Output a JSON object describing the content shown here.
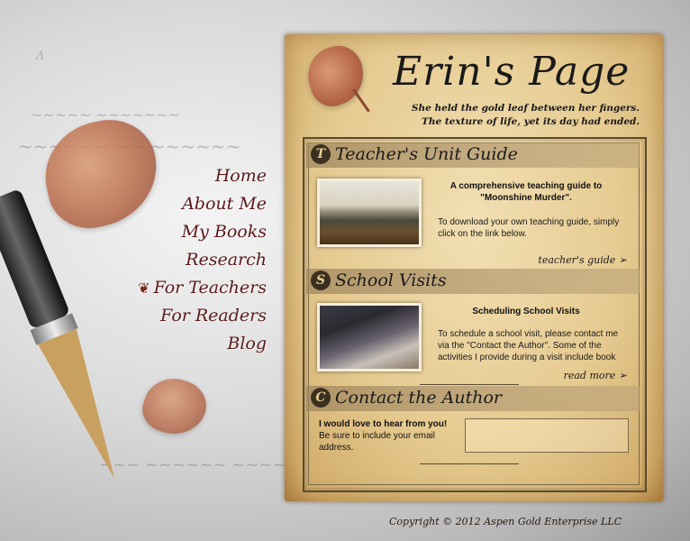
{
  "site": {
    "title": "Erin's Page",
    "tagline_line1": "She held the gold leaf between her fingers.",
    "tagline_line2": "The texture of life, yet its day had ended."
  },
  "nav": {
    "items": [
      {
        "label": "Home"
      },
      {
        "label": "About Me"
      },
      {
        "label": "My Books"
      },
      {
        "label": "Research"
      },
      {
        "label": "For Teachers"
      },
      {
        "label": "For Readers"
      },
      {
        "label": "Blog"
      }
    ]
  },
  "sections": {
    "teacher": {
      "cap": "T",
      "heading": "Teacher's Unit Guide",
      "title": "A comprehensive teaching guide to \"Moonshine Murder\".",
      "text": "To download your own teaching guide, simply click on the link below.",
      "link": "teacher's guide ➢"
    },
    "school": {
      "cap": "S",
      "heading": "School Visits",
      "title": "Scheduling School Visits",
      "text": "To schedule a school visit, please contact me via the \"Contact the Author\". Some of the activities I provide during a visit include book",
      "link": "read more ➢"
    },
    "contact": {
      "cap": "C",
      "heading": "Contact the Author",
      "bold": "I would love to hear from you!",
      "text": " Be sure to include your email address."
    }
  },
  "footer": {
    "copyright": "Copyright © 2012 Aspen Gold Enterprise LLC"
  },
  "colors": {
    "nav_text": "#5a1a1a",
    "parchment": "#e6cb91"
  }
}
